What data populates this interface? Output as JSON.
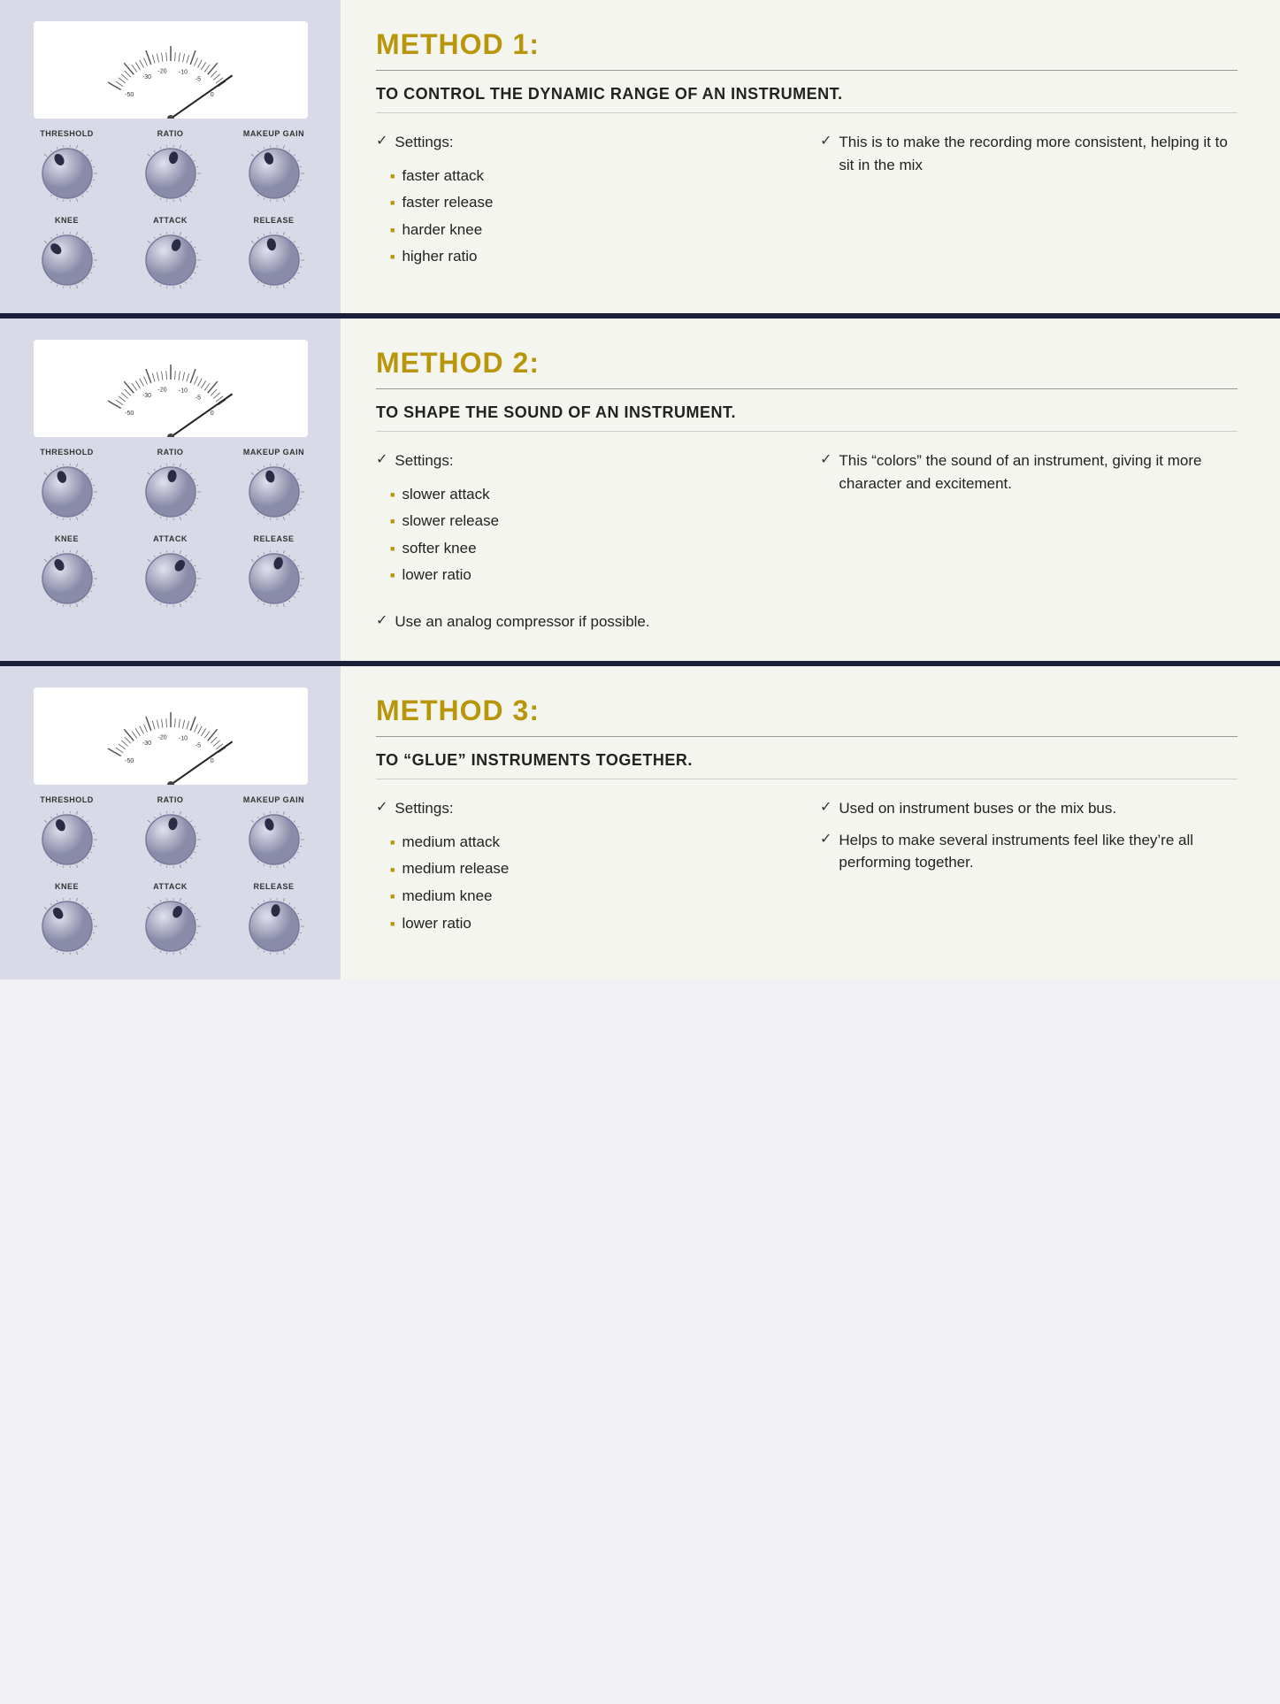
{
  "methods": [
    {
      "id": "method1",
      "title": "METHOD 1:",
      "subtitle": "TO CONTROL THE DYNAMIC RANGE OF AN INSTRUMENT.",
      "settings_label": "Settings:",
      "bullets": [
        "faster attack",
        "faster release",
        "harder knee",
        "higher ratio"
      ],
      "note_label": "This is to make the recording more consistent, helping it to sit in the mix",
      "extra_check": null,
      "knob_rows": [
        {
          "labels": [
            "THRESHOLD",
            "RATIO",
            "MAKEUP GAIN"
          ],
          "angles": [
            -30,
            10,
            -20
          ]
        },
        {
          "labels": [
            "KNEE",
            "ATTACK",
            "RELEASE"
          ],
          "angles": [
            -45,
            20,
            -10
          ]
        }
      ]
    },
    {
      "id": "method2",
      "title": "METHOD 2:",
      "subtitle": "TO SHAPE THE SOUND OF AN INSTRUMENT.",
      "settings_label": "Settings:",
      "bullets": [
        "slower attack",
        "slower release",
        "softer knee",
        "lower ratio"
      ],
      "note_label": "This “colors” the sound of an instrument, giving it more character and excitement.",
      "extra_check": "Use an analog compressor if possible.",
      "knob_rows": [
        {
          "labels": [
            "THRESHOLD",
            "RATIO",
            "MAKEUP GAIN"
          ],
          "angles": [
            -20,
            5,
            -15
          ]
        },
        {
          "labels": [
            "KNEE",
            "ATTACK",
            "RELEASE"
          ],
          "angles": [
            -30,
            35,
            15
          ]
        }
      ]
    },
    {
      "id": "method3",
      "title": "METHOD 3:",
      "subtitle": "TO “GLUE” INSTRUMENTS TOGETHER.",
      "settings_label": "Settings:",
      "bullets": [
        "medium attack",
        "medium release",
        "medium knee",
        "lower ratio"
      ],
      "note_label": "Used on instrument buses or the mix bus.",
      "note_label2": "Helps to make several instruments feel like they’re all performing together.",
      "extra_check": null,
      "knob_rows": [
        {
          "labels": [
            "THRESHOLD",
            "RATIO",
            "MAKEUP GAIN"
          ],
          "angles": [
            -25,
            8,
            -18
          ]
        },
        {
          "labels": [
            "KNEE",
            "ATTACK",
            "RELEASE"
          ],
          "angles": [
            -35,
            25,
            5
          ]
        }
      ]
    }
  ],
  "check_symbol": "✓",
  "accent_color": "#b8960a"
}
